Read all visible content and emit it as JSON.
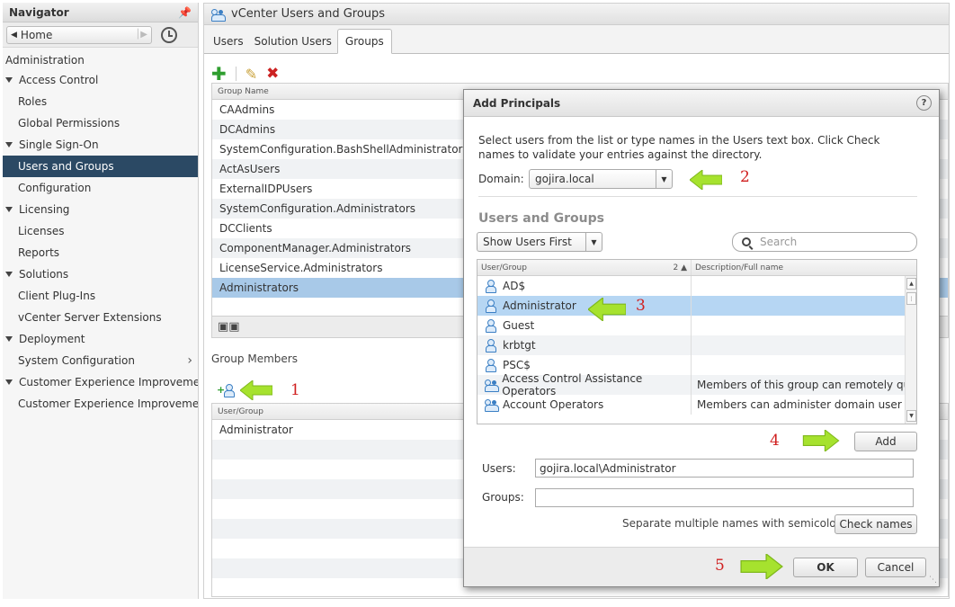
{
  "navigator": {
    "title": "Navigator",
    "home_label": "Home",
    "section": "Administration",
    "items": [
      {
        "label": "Access Control",
        "type": "group"
      },
      {
        "label": "Roles",
        "type": "child"
      },
      {
        "label": "Global Permissions",
        "type": "child"
      },
      {
        "label": "Single Sign-On",
        "type": "group"
      },
      {
        "label": "Users and Groups",
        "type": "child",
        "selected": true
      },
      {
        "label": "Configuration",
        "type": "child"
      },
      {
        "label": "Licensing",
        "type": "group"
      },
      {
        "label": "Licenses",
        "type": "child"
      },
      {
        "label": "Reports",
        "type": "child"
      },
      {
        "label": "Solutions",
        "type": "group"
      },
      {
        "label": "Client Plug-Ins",
        "type": "child"
      },
      {
        "label": "vCenter Server Extensions",
        "type": "child"
      },
      {
        "label": "Deployment",
        "type": "group"
      },
      {
        "label": "System Configuration",
        "type": "child",
        "chevron": true
      },
      {
        "label": "Customer Experience Improvement P",
        "type": "group"
      },
      {
        "label": "Customer Experience Improveme...",
        "type": "child"
      }
    ]
  },
  "main": {
    "title": "vCenter Users and Groups",
    "tabs": [
      "Users",
      "Solution Users",
      "Groups"
    ],
    "active_tab": "Groups",
    "group_grid": {
      "header": "Group Name",
      "rows": [
        "CAAdmins",
        "DCAdmins",
        "SystemConfiguration.BashShellAdministrators",
        "ActAsUsers",
        "ExternalIDPUsers",
        "SystemConfiguration.Administrators",
        "DCClients",
        "ComponentManager.Administrators",
        "LicenseService.Administrators",
        "Administrators"
      ],
      "selected": "Administrators"
    },
    "group_members": {
      "title": "Group Members",
      "header": "User/Group",
      "rows": [
        "Administrator"
      ]
    }
  },
  "dialog": {
    "title": "Add Principals",
    "help": "?",
    "description": "Select users from the list or type names in the Users text box. Click Check names to validate your entries against the directory.",
    "domain_label": "Domain:",
    "domain_value": "gojira.local",
    "section_title": "Users and Groups",
    "show_filter": "Show Users First",
    "search_placeholder": "Search",
    "grid": {
      "col_user": "User/Group",
      "sort_indicator": "2 ▲",
      "col_desc": "Description/Full name",
      "rows": [
        {
          "name": "AD$",
          "desc": "",
          "icon": "user"
        },
        {
          "name": "Administrator",
          "desc": "",
          "icon": "user",
          "selected": true
        },
        {
          "name": "Guest",
          "desc": "",
          "icon": "user"
        },
        {
          "name": "krbtgt",
          "desc": "",
          "icon": "user"
        },
        {
          "name": "PSC$",
          "desc": "",
          "icon": "user"
        },
        {
          "name": "Access Control Assistance Operators",
          "desc": "Members of this group can remotely qu...",
          "icon": "group"
        },
        {
          "name": "Account Operators",
          "desc": "Members can administer domain user ...",
          "icon": "group"
        }
      ]
    },
    "add_label": "Add",
    "users_label": "Users:",
    "users_value": "gojira.local\\Administrator",
    "groups_label": "Groups:",
    "groups_value": "",
    "hint": "Separate multiple names with semicolons",
    "check_names_label": "Check names",
    "ok_label": "OK",
    "cancel_label": "Cancel"
  },
  "annotations": {
    "step1": "1",
    "step2": "2",
    "step3": "3",
    "step4": "4",
    "step5": "5",
    "arrow_color": "#a6e22e",
    "number_color": "#d02020"
  }
}
